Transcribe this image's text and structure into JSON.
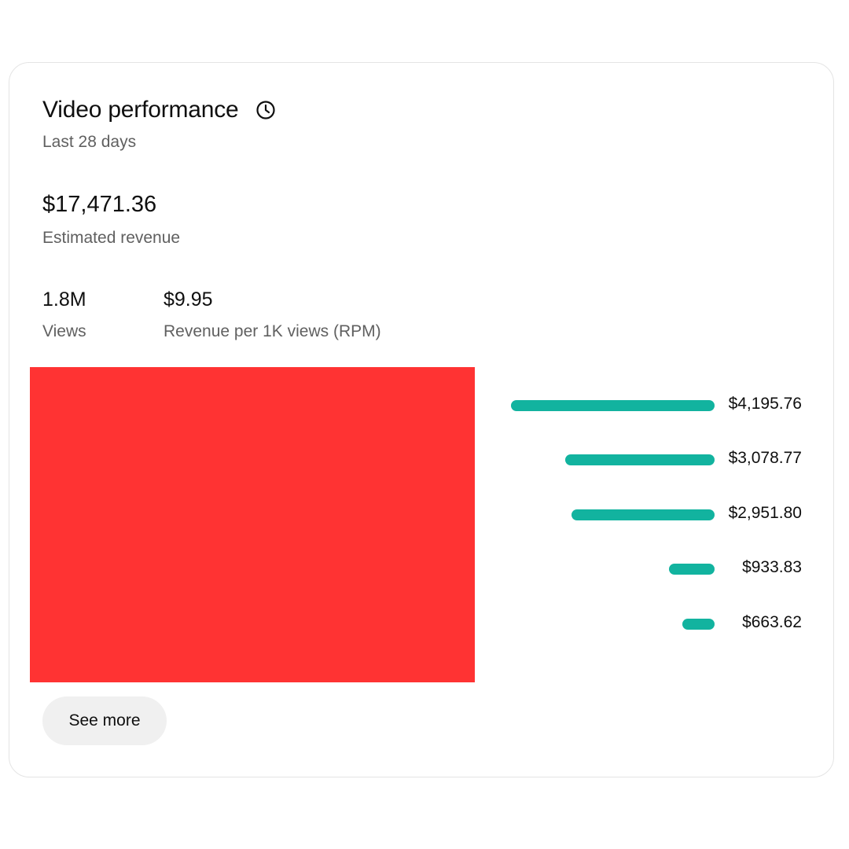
{
  "card": {
    "title": "Video performance",
    "history_icon": "clock-icon",
    "subtitle": "Last 28 days"
  },
  "revenue": {
    "value": "$17,471.36",
    "label": "Estimated revenue"
  },
  "metrics": [
    {
      "value": "1.8M",
      "label": "Views"
    },
    {
      "value": "$9.95",
      "label": "Revenue per 1K views (RPM)"
    }
  ],
  "top_content": {
    "bar_color": "#12b39f",
    "items": [
      {
        "amount": "$4,195.76",
        "value": 4195.76
      },
      {
        "amount": "$3,078.77",
        "value": 3078.77
      },
      {
        "amount": "$2,951.80",
        "value": 2951.8
      },
      {
        "amount": "$933.83",
        "value": 933.83
      },
      {
        "amount": "$663.62",
        "value": 663.62
      }
    ]
  },
  "redaction_color": "#ff3333",
  "actions": {
    "see_more_label": "See more"
  }
}
